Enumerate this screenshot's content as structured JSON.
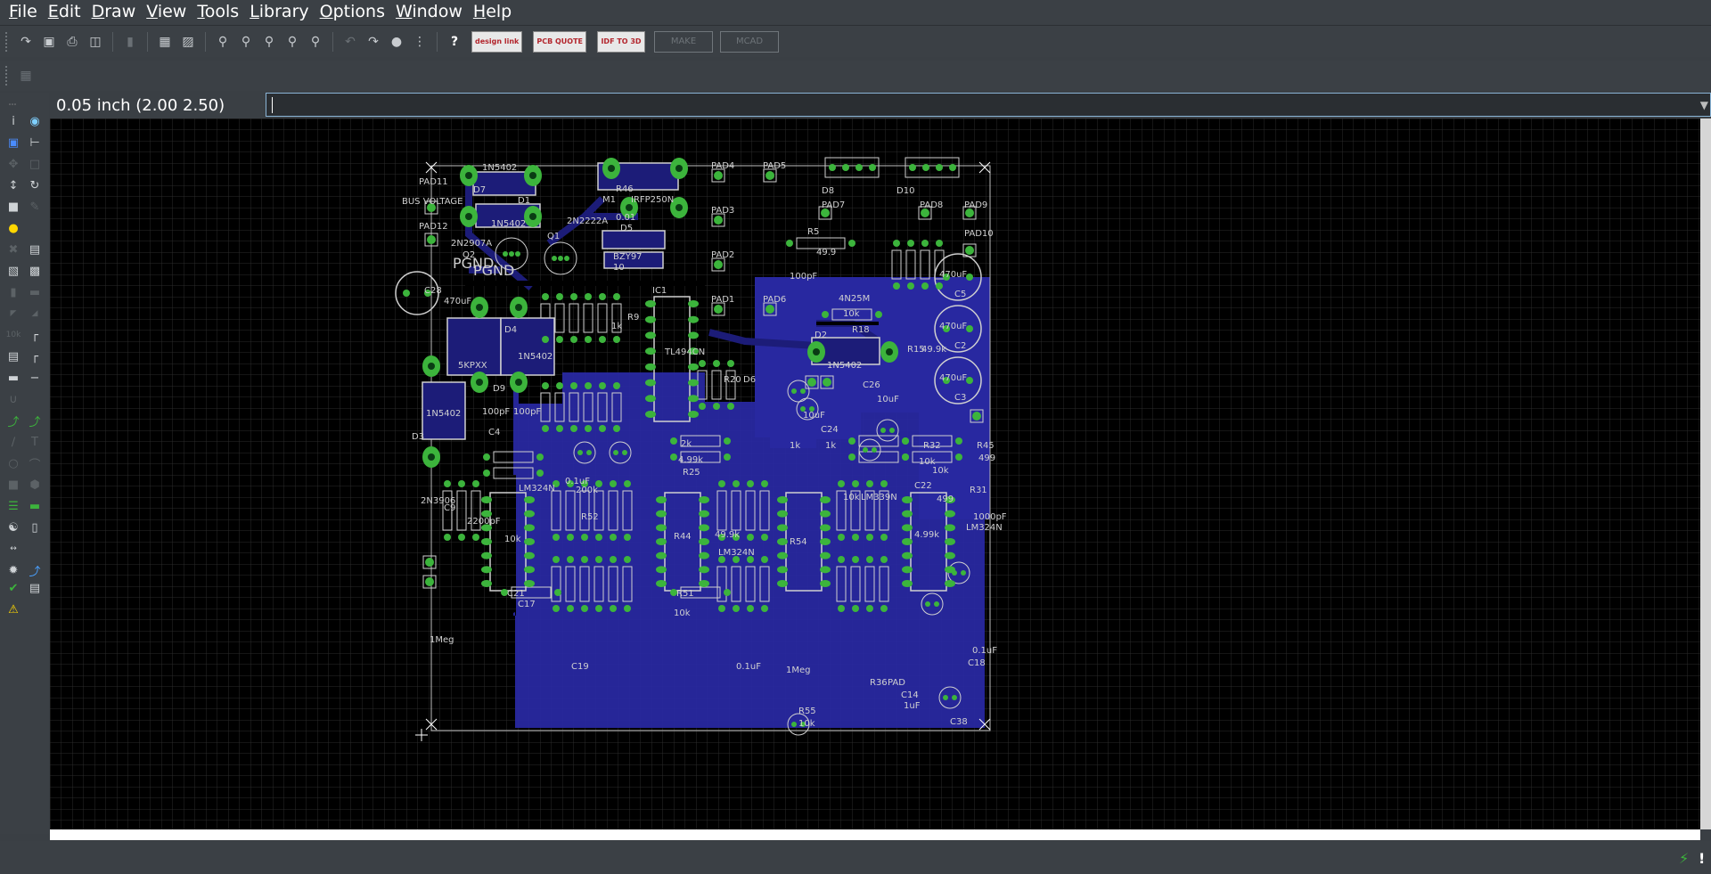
{
  "menu": [
    "File",
    "Edit",
    "Draw",
    "View",
    "Tools",
    "Library",
    "Options",
    "Window",
    "Help"
  ],
  "toolbar": {
    "designlink_label": "design link",
    "pcb_quote_label": "PCB QUOTE",
    "idf_label": "IDF TO 3D",
    "make_label": "MAKE",
    "mcad_label": "MCAD"
  },
  "coord": {
    "readout": "0.05 inch (2.00 2.50)",
    "command_value": ""
  },
  "colors": {
    "chrome": "#3b4045",
    "canvas_bg": "#000000",
    "grid": "#2b2b2b",
    "copper_pour": "#2828a0",
    "copper_dark": "#1c1c78",
    "silkscreen": "#d0d0d0",
    "pad": "#3cb43c",
    "pad_hole": "#0a3c14",
    "outline": "#ffffff"
  },
  "pcb": {
    "texts": [
      "1N5402",
      "D7",
      "D1",
      "1N5402",
      "BUS VOLTAGE",
      "PAD11",
      "PAD12",
      "2N2907A",
      "Q2",
      "2N2222A",
      "Q1",
      "PGND",
      "PGND",
      "R46",
      "M1",
      "IRFP250N",
      "0.01",
      "D5",
      "BZY97",
      "10",
      "PAD4",
      "PAD3",
      "PAD2",
      "PAD1",
      "PAD5",
      "D8",
      "D10",
      "PAD7",
      "PAD8",
      "PAD9",
      "PAD10",
      "R5",
      "49.9",
      "100pF",
      "4N25M",
      "R18",
      "10k",
      "470uF",
      "C5",
      "470uF",
      "C2",
      "470uF",
      "C3",
      "PAD6",
      "C28",
      "470uF",
      "5KPXX",
      "D4",
      "1N5402",
      "D9",
      "IC1",
      "TL494CN",
      "R9",
      "1k",
      "D2",
      "1N5402",
      "R15",
      "49.9k",
      "C26",
      "10uF",
      "10uF",
      "C24",
      "D6",
      "R20",
      "D3",
      "1N5402",
      "100pF",
      "100pF",
      "C4",
      "2k",
      "4.99k",
      "R25",
      "1k",
      "1k",
      "R32",
      "10k",
      "10k",
      "R45",
      "499",
      "R31",
      "2N3906",
      "C9",
      "2200pF",
      "10k",
      "LM324N",
      "0.1uF",
      "200k",
      "R52",
      "R44",
      "49.9k",
      "LM324N",
      "R54",
      "10k",
      "LM339N",
      "4.99k",
      "499",
      "LM324N",
      "1000pF",
      "C22",
      "C21",
      "C17",
      "R51",
      "10k",
      "R55",
      "10k",
      "C14",
      "1uF",
      "C38",
      "0.1uF",
      "C18",
      "C19",
      "0.1uF",
      "1Meg",
      "1Meg",
      "R36",
      "PAD"
    ]
  }
}
